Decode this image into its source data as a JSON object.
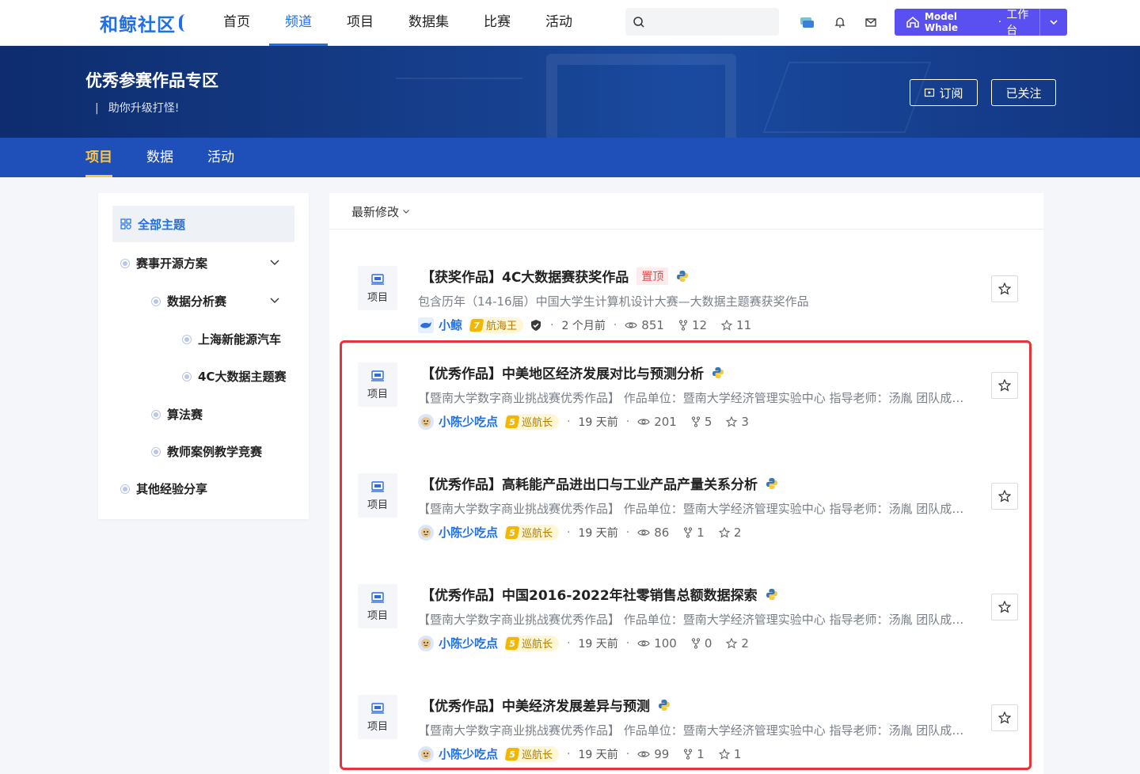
{
  "header": {
    "logo": "和鲸社区",
    "nav": [
      "首页",
      "频道",
      "项目",
      "数据集",
      "比赛",
      "活动"
    ],
    "active_nav": 1,
    "workspace": {
      "brand": "Model Whale",
      "sep": "·",
      "label": "工作台"
    }
  },
  "banner": {
    "title": "优秀参赛作品专区",
    "subtitle": "助你升级打怪!",
    "subscribe_label": "订阅",
    "follow_label": "已关注"
  },
  "subtabs": [
    "项目",
    "数据",
    "活动"
  ],
  "sidebar": {
    "head": "全部主题",
    "items": [
      "赛事开源方案",
      "数据分析赛",
      "上海新能源汽车",
      "4C大数据主题赛",
      "算法赛",
      "教师案例教学竞赛",
      "其他经验分享"
    ]
  },
  "list": {
    "sort_label": "最新修改",
    "type_label": "项目",
    "pin_label": "置顶",
    "items": [
      {
        "title": "【获奖作品】4C大数据赛获奖作品",
        "desc": "包含历年（14-16届）中国大学生计算机设计大赛—大数据主题赛获奖作品",
        "author": "小鲸",
        "level": "7",
        "badge": "航海王",
        "time": "2 个月前",
        "views": "851",
        "forks": "12",
        "stars": "11"
      },
      {
        "title": "【优秀作品】中美地区经济发展对比与预测分析",
        "desc": "【暨南大学数字商业挑战赛优秀作品】 作品单位：暨南大学经济管理实验中心 指导老师：汤胤 团队成员：周梓琳、曾欣、傅思思",
        "author": "小陈少吃点",
        "level": "5",
        "badge": "巡航长",
        "time": "19 天前",
        "views": "201",
        "forks": "5",
        "stars": "3"
      },
      {
        "title": "【优秀作品】高耗能产品进出口与工业产品产量关系分析",
        "desc": "【暨南大学数字商业挑战赛优秀作品】 作品单位：暨南大学经济管理实验中心 指导老师：汤胤 团队成员：李明、王芳、陈晓",
        "author": "小陈少吃点",
        "level": "5",
        "badge": "巡航长",
        "time": "19 天前",
        "views": "86",
        "forks": "1",
        "stars": "2"
      },
      {
        "title": "【优秀作品】中国2016-2022年社零销售总额数据探索",
        "desc": "【暨南大学数字商业挑战赛优秀作品】 作品单位：暨南大学经济管理实验中心 指导老师：汤胤 团队成员：林一、黄二、张三",
        "author": "小陈少吃点",
        "level": "5",
        "badge": "巡航长",
        "time": "19 天前",
        "views": "100",
        "forks": "0",
        "stars": "2"
      },
      {
        "title": "【优秀作品】中美经济发展差异与预测",
        "desc": "【暨南大学数字商业挑战赛优秀作品】 作品单位：暨南大学经济管理实验中心 指导老师：汤胤 团队成员：赵四、钱五、孙六",
        "author": "小陈少吃点",
        "level": "5",
        "badge": "巡航长",
        "time": "19 天前",
        "views": "99",
        "forks": "1",
        "stars": "1"
      }
    ]
  }
}
